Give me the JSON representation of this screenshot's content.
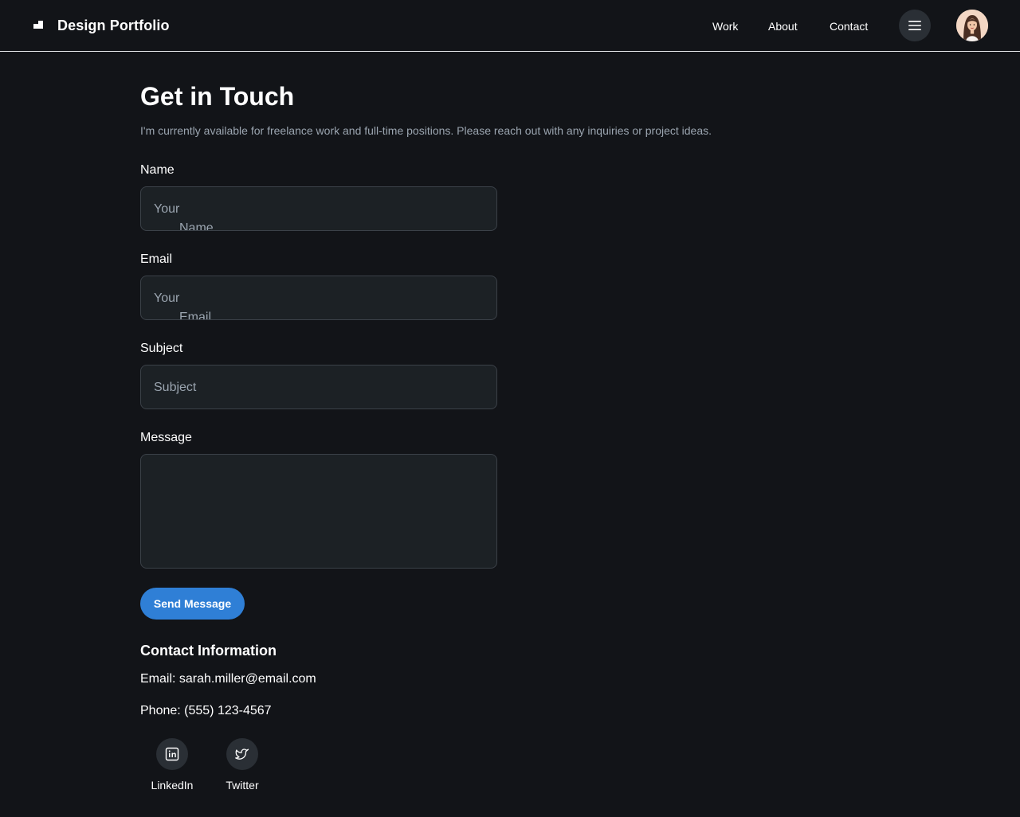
{
  "header": {
    "brand_title": "Design Portfolio",
    "nav": [
      {
        "label": "Work"
      },
      {
        "label": "About"
      },
      {
        "label": "Contact"
      }
    ],
    "menu_icon": "hamburger-menu-icon",
    "avatar_icon": "user-avatar"
  },
  "main": {
    "title": "Get in Touch",
    "intro": "I'm currently available for freelance work and full-time positions. Please reach out with any inquiries or project ideas.",
    "form": {
      "name": {
        "label": "Name",
        "placeholder_line1": "Your",
        "placeholder_line2": "Name",
        "value": ""
      },
      "email": {
        "label": "Email",
        "placeholder_line1": "Your",
        "placeholder_line2": "Email",
        "value": ""
      },
      "subject": {
        "label": "Subject",
        "placeholder": "Subject",
        "value": ""
      },
      "message": {
        "label": "Message",
        "value": ""
      },
      "submit_label": "Send Message"
    },
    "contact": {
      "title": "Contact Information",
      "email_line": "Email: sarah.miller@email.com",
      "phone_line": "Phone: (555) 123-4567"
    },
    "social": [
      {
        "label": "LinkedIn",
        "icon": "linkedin-icon"
      },
      {
        "label": "Twitter",
        "icon": "twitter-icon"
      }
    ]
  },
  "colors": {
    "background": "#121418",
    "input_background": "#1c2125",
    "input_border": "#3b4148",
    "accent": "#2f7fd6",
    "muted_text": "#9ba5b0"
  }
}
